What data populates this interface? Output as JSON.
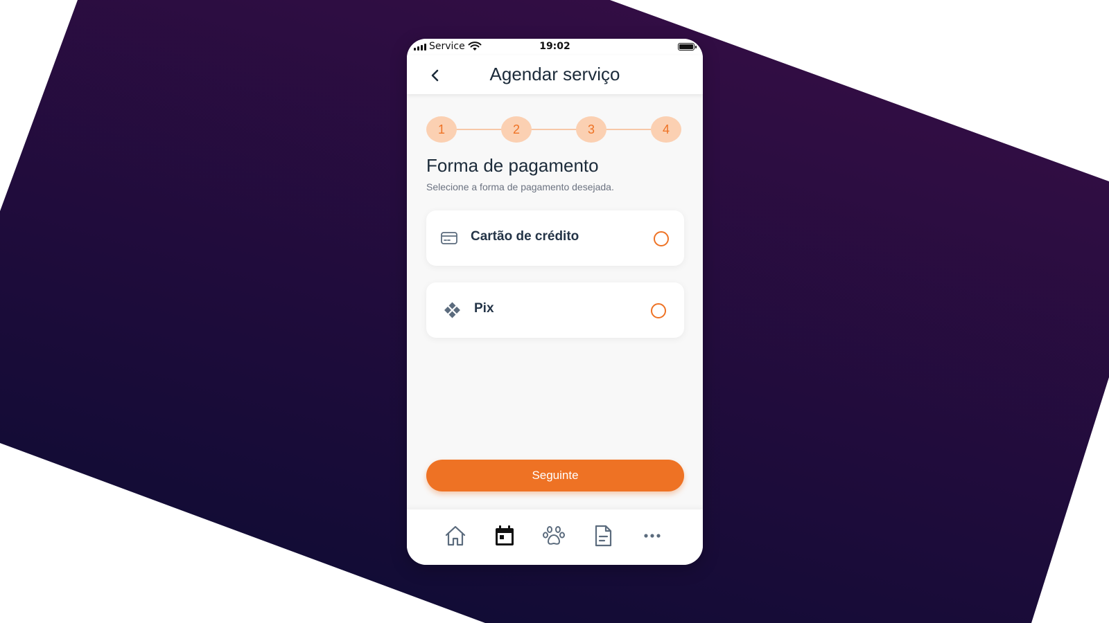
{
  "status_bar": {
    "carrier": "Service",
    "time": "19:02"
  },
  "header": {
    "title": "Agendar serviço",
    "back_icon": "chevron-left-icon"
  },
  "stepper": {
    "steps": [
      "1",
      "2",
      "3",
      "4"
    ],
    "color": "#ee7224",
    "background": "#fbd0b2"
  },
  "section": {
    "title": "Forma de pagamento",
    "subtitle": "Selecione a forma de pagamento desejada."
  },
  "options": [
    {
      "label": "Cartão de crédito",
      "icon": "credit-card-icon",
      "selected": false
    },
    {
      "label": "Pix",
      "icon": "pix-icon",
      "selected": false
    }
  ],
  "next_button": {
    "label": "Seguinte"
  },
  "tab_bar": {
    "items": [
      {
        "icon": "home-icon",
        "active": false
      },
      {
        "icon": "calendar-icon",
        "active": true
      },
      {
        "icon": "paw-icon",
        "active": false
      },
      {
        "icon": "document-icon",
        "active": false
      },
      {
        "icon": "more-icon",
        "active": false
      }
    ]
  },
  "colors": {
    "accent": "#ee7224",
    "background_gradient": [
      "#350d45",
      "#0f0c34"
    ],
    "text_dark": "#1c2b3a"
  }
}
